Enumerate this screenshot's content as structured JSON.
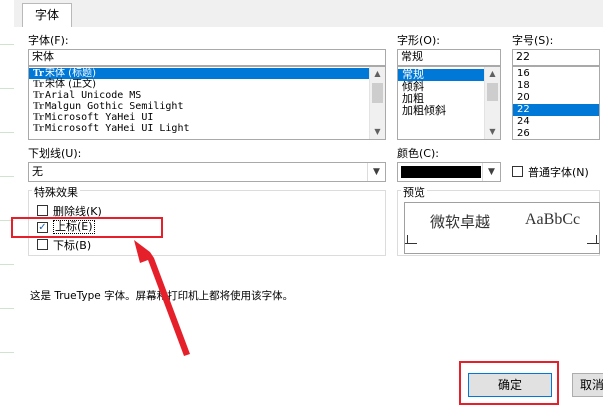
{
  "tab": {
    "label": "字体"
  },
  "font": {
    "label": "字体(F):",
    "value": "宋体",
    "items": [
      "宋体 (标题)",
      "宋体 (正文)",
      "Arial Unicode MS",
      "Malgun Gothic Semilight",
      "Microsoft YaHei UI",
      "Microsoft YaHei UI Light"
    ],
    "selected_index": 0
  },
  "style": {
    "label": "字形(O):",
    "value": "常规",
    "items": [
      "常规",
      "倾斜",
      "加粗",
      "加粗倾斜"
    ],
    "selected_index": 0
  },
  "size": {
    "label": "字号(S):",
    "value": "22",
    "items": [
      "16",
      "18",
      "20",
      "22",
      "24",
      "26"
    ],
    "selected_index": 3
  },
  "underline": {
    "label": "下划线(U):",
    "value": "无"
  },
  "color": {
    "label": "颜色(C):",
    "swatch": "#000000"
  },
  "normal_font": {
    "label": "普通字体(N)",
    "checked": false
  },
  "effects": {
    "title": "特殊效果",
    "strikethrough": {
      "label": "删除线(K)",
      "checked": false
    },
    "superscript": {
      "label": "上标(E)",
      "checked": true
    },
    "subscript": {
      "label": "下标(B)",
      "checked": false
    }
  },
  "preview": {
    "title": "预览",
    "sample_cn": "微软卓越",
    "sample_en": "AaBbCc"
  },
  "info": "这是 TrueType 字体。屏幕和打印机上都将使用该字体。",
  "buttons": {
    "ok": "确定",
    "cancel": "取消"
  },
  "annotation_color": "#e5202a",
  "selection_color": "#0078d7"
}
